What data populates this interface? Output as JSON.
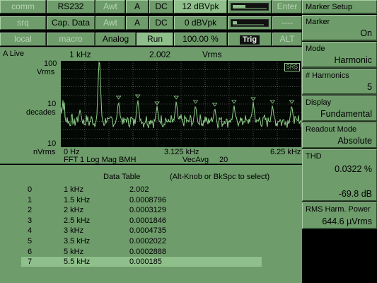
{
  "status": {
    "row1": [
      "comm",
      "RS232",
      "Awt",
      "A",
      "DC",
      "12 dBVpk",
      "",
      "Enter"
    ],
    "row2": [
      "srq",
      "Cap. Data",
      "Awt",
      "A",
      "DC",
      "0 dBVpk",
      "",
      "----"
    ],
    "row3": [
      "local",
      "macro",
      "Analog",
      "Run",
      "100.00 %",
      "Trig",
      "ALT"
    ]
  },
  "menu": {
    "title": "Marker Setup",
    "marker": {
      "label": "Marker",
      "value": "On"
    },
    "mode": {
      "label": "Mode",
      "value": "Harmonic"
    },
    "harmonics": {
      "label": "# Harmonics",
      "value": "5"
    },
    "display": {
      "label": "Display",
      "value": "Fundamental"
    },
    "readout": {
      "label": "Readout Mode",
      "value": "Absolute"
    },
    "thd": {
      "label": "THD",
      "value1": "0.0322 %",
      "value2": "-69.8 dB"
    },
    "rms": {
      "label": "RMS Harm. Power",
      "value": "644.6 µVrms"
    }
  },
  "graph": {
    "title": "A Live",
    "marker_freq": "1 kHz",
    "marker_value": "2.002",
    "marker_unit": "Vrms",
    "y_top": "100",
    "y_top_unit": "Vrms",
    "y_mid": "10",
    "y_mid_unit": "decades",
    "y_bot": "10",
    "y_bot_unit": "nVrms",
    "x_start": "0 Hz",
    "x_mid": "3.125 kHz",
    "x_end": "6.25 kHz",
    "measurement": "FFT 1 Log Mag BMH",
    "averaging": "VecAvg",
    "avg_count": "20",
    "logo": "SRS"
  },
  "table": {
    "title": "Data Table",
    "hint": "(Alt-Knob or BkSpc to select)",
    "rows": [
      {
        "idx": "0",
        "freq": "1 kHz",
        "value": "2.002"
      },
      {
        "idx": "1",
        "freq": "1.5 kHz",
        "value": "0.0008796"
      },
      {
        "idx": "2",
        "freq": "2 kHz",
        "value": "0.0003129"
      },
      {
        "idx": "3",
        "freq": "2.5 kHz",
        "value": "0.0001846"
      },
      {
        "idx": "4",
        "freq": "3 kHz",
        "value": "0.0004735"
      },
      {
        "idx": "5",
        "freq": "3.5 kHz",
        "value": "0.0002022"
      },
      {
        "idx": "6",
        "freq": "5 kHz",
        "value": "0.0002888"
      },
      {
        "idx": "7",
        "freq": "5.5 kHz",
        "value": "0.000185"
      }
    ],
    "selected_row": "7"
  },
  "colors": {
    "panel": "#6e9c6b",
    "trace": "#8fd08a",
    "selected": "#8fc08b",
    "plot_bg": "#040804"
  }
}
